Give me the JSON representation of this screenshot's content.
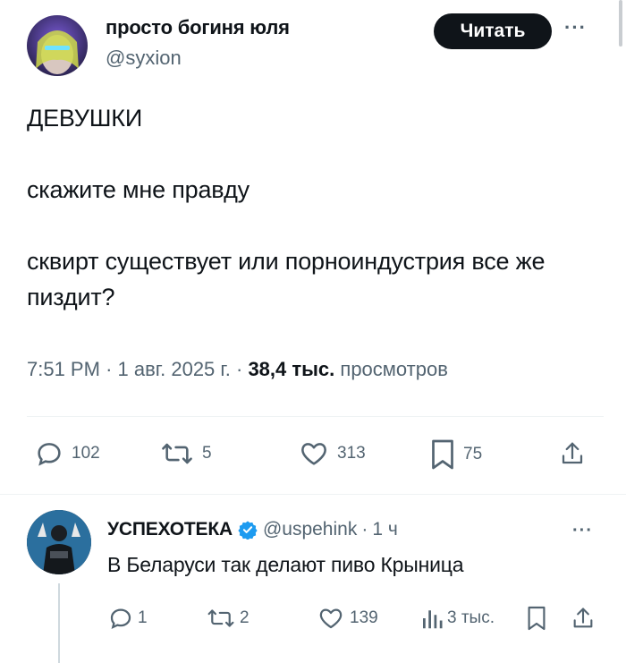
{
  "tweet": {
    "author": {
      "name": "просто богиня юля",
      "handle": "@syxion"
    },
    "follow_label": "Читать",
    "more_label": "···",
    "text": "ДЕВУШКИ\n\nскажите мне правду\n\nсквирт существует или порноиндустрия все же пиздит?",
    "time": "7:51 PM",
    "separator": "·",
    "date": "1 авг. 2025 г.",
    "views_count": "38,4 тыс.",
    "views_label": "просмотров",
    "actions": {
      "replies": "102",
      "reposts": "5",
      "likes": "313",
      "bookmarks": "75"
    },
    "icons": [
      "reply-icon",
      "repost-icon",
      "like-icon",
      "bookmark-icon",
      "share-icon"
    ]
  },
  "reply": {
    "author": {
      "name": "УСПЕХОТЕКА",
      "handle": "@uspehink",
      "time": "1 ч"
    },
    "separator": "·",
    "more_label": "···",
    "text": "В Беларуси так делают пиво Крыница",
    "actions": {
      "replies": "1",
      "reposts": "2",
      "likes": "139",
      "views": "3 тыс."
    },
    "icons": [
      "reply-icon",
      "repost-icon",
      "like-icon",
      "views-icon",
      "bookmark-icon",
      "share-icon",
      "verified-badge-icon"
    ]
  },
  "colors": {
    "text": "#0f1419",
    "secondary": "#536471",
    "follow_button": "#0f1419",
    "verified": "#1d9bf0",
    "divider": "#eff3f4"
  }
}
